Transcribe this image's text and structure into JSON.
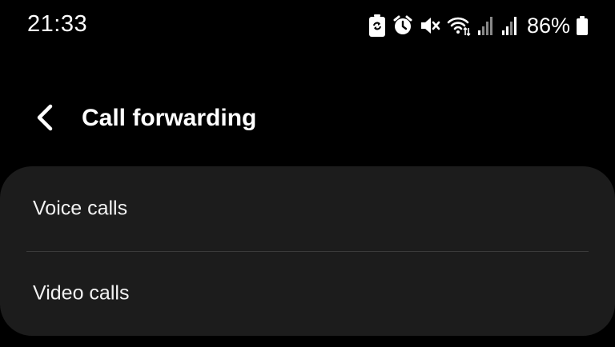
{
  "status_bar": {
    "time": "21:33",
    "battery_percent": "86%",
    "icons": [
      "battery-saver-icon",
      "alarm-icon",
      "mute-icon",
      "wifi-icon",
      "signal-1-icon",
      "signal-2-icon",
      "battery-icon"
    ]
  },
  "header": {
    "back_icon": "chevron-left-icon",
    "title": "Call forwarding"
  },
  "list": {
    "items": [
      {
        "label": "Voice calls"
      },
      {
        "label": "Video calls"
      }
    ]
  },
  "colors": {
    "background": "#000000",
    "card": "#1c1c1c",
    "divider": "#3a3a3a",
    "text": "#ffffff"
  }
}
